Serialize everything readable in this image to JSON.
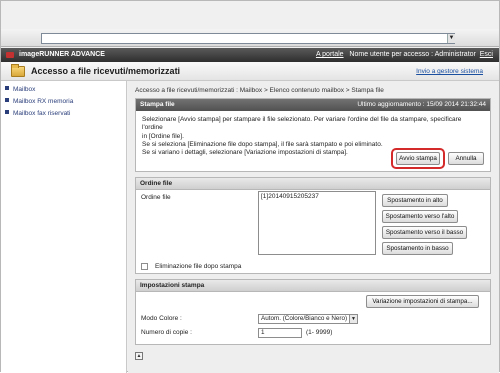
{
  "browser": {
    "address_value": ""
  },
  "header": {
    "brand": "imageRUNNER ADVANCE",
    "portal_link": "A portale",
    "user_label": "Nome utente per accesso : Administrator",
    "exit_link": "Esci"
  },
  "title": {
    "text": "Accesso a file ricevuti/memorizzati",
    "system_link": "Invio a gestore sistema"
  },
  "sidebar": {
    "items": [
      {
        "label": "Mailbox"
      },
      {
        "label": "Mailbox RX memoria"
      },
      {
        "label": "Mailbox fax riservati"
      }
    ]
  },
  "main": {
    "breadcrumb": "Accesso a file ricevuti/memorizzati : Mailbox > Elenco contenuto mailbox > Stampa file",
    "print_panel": {
      "title": "Stampa file",
      "updated": "Ultimo aggiornamento : 15/09 2014 21:32:44",
      "desc_lines": [
        "Selezionare [Avvio stampa] per stampare il file selezionato. Per variare l'ordine del file da stampare, specificare l'ordine",
        "in [Ordine file].",
        "Se si seleziona [Eliminazione file dopo stampa], il file sarà stampato e poi eliminato.",
        "Se si variano i dettagli, selezionare [Variazione impostazioni di stampa]."
      ],
      "start_button": "Avvio stampa",
      "cancel_button": "Annulla"
    },
    "order_panel": {
      "title": "Ordine file",
      "label": "Ordine file",
      "files": [
        "[1]20140915205237"
      ],
      "buttons": {
        "top": "Spostamento in alto",
        "up": "Spostamento verso l'alto",
        "down": "Spostamento verso il basso",
        "bottom": "Spostamento in basso"
      },
      "delete_after_print": "Eliminazione file dopo stampa"
    },
    "settings_panel": {
      "title": "Impostazioni stampa",
      "change_button": "Variazione impostazioni di stampa...",
      "color_mode_label": "Modo Colore :",
      "color_mode_value": "Autom. (Colore/Bianco e Nero)",
      "copies_label": "Numero di copie :",
      "copies_value": "1",
      "copies_range": "(1- 9999)"
    }
  },
  "colors": {
    "highlight": "#d42a2a",
    "link": "#1a4fa0",
    "header_dark": "#3a3a3a"
  }
}
